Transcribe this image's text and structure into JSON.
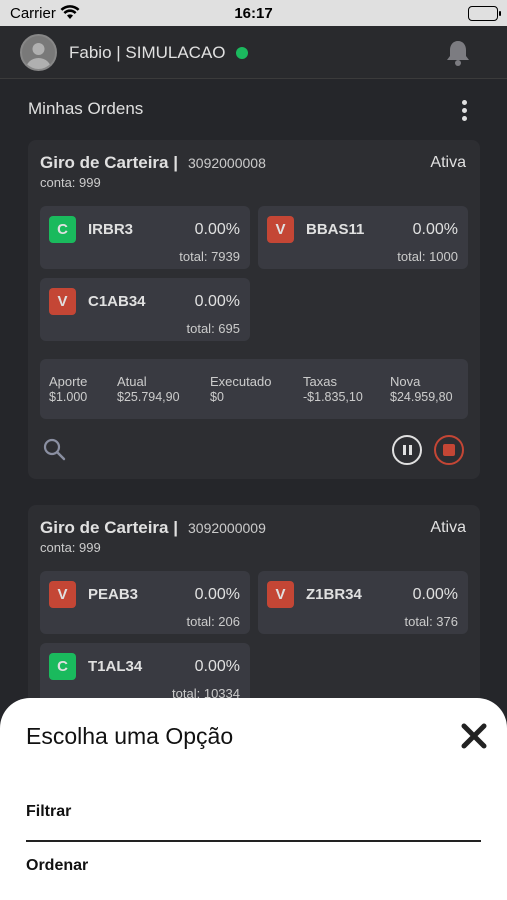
{
  "status_bar": {
    "carrier": "Carrier",
    "time": "16:17"
  },
  "header": {
    "user_label": "Fabio | SIMULACAO",
    "online_color": "#1fd36b",
    "icons": [
      "avatar-icon",
      "bell-icon"
    ]
  },
  "main": {
    "title": "Minhas Ordens"
  },
  "orders": [
    {
      "title": "Giro de Carteira |",
      "id": "3092000008",
      "account": "conta: 999",
      "status": "Ativa",
      "assets": [
        {
          "side": "C",
          "ticker": "IRBR3",
          "pct": "0.00%",
          "total": "total: 7939"
        },
        {
          "side": "V",
          "ticker": "BBAS11",
          "pct": "0.00%",
          "total": "total: 1000"
        },
        {
          "side": "V",
          "ticker": "C1AB34",
          "pct": "0.00%",
          "total": "total: 695"
        }
      ],
      "summary": [
        {
          "label": "Aporte",
          "value": "$1.000"
        },
        {
          "label": "Atual",
          "value": "$25.794,90"
        },
        {
          "label": "Executado",
          "value": "$0"
        },
        {
          "label": "Taxas",
          "value": "-$1.835,10"
        },
        {
          "label": "Nova",
          "value": "$24.959,80"
        }
      ]
    },
    {
      "title": "Giro de Carteira |",
      "id": "3092000009",
      "account": "conta: 999",
      "status": "Ativa",
      "assets": [
        {
          "side": "V",
          "ticker": "PEAB3",
          "pct": "0.00%",
          "total": "total: 206"
        },
        {
          "side": "V",
          "ticker": "Z1BR34",
          "pct": "0.00%",
          "total": "total: 376"
        },
        {
          "side": "C",
          "ticker": "T1AL34",
          "pct": "0.00%",
          "total": "total: 10334"
        }
      ]
    }
  ],
  "sheet": {
    "title": "Escolha uma Opção",
    "options": [
      "Filtrar",
      "Ordenar"
    ]
  },
  "colors": {
    "buy": "#1ed46a",
    "sell": "#e0503d",
    "background": "#2b2c30",
    "card": "#34353a"
  }
}
